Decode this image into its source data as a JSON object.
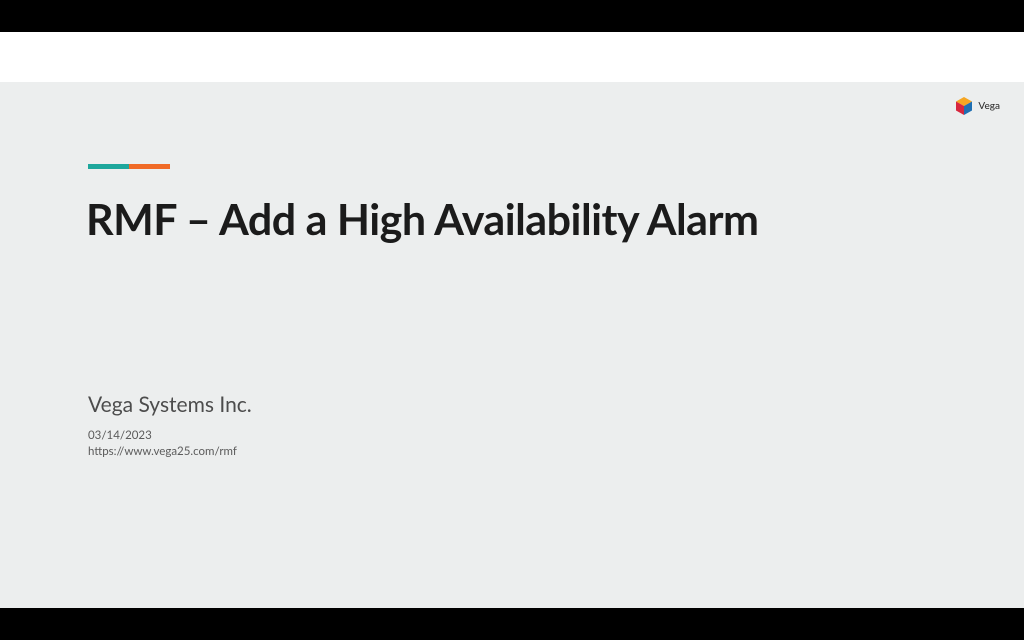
{
  "brand": {
    "name": "Vega"
  },
  "slide": {
    "title": "RMF – Add a High Availability Alarm",
    "company": "Vega Systems Inc.",
    "date": "03/14/2023",
    "url": "https://www.vega25.com/rmf"
  },
  "colors": {
    "accent_teal": "#1ea79c",
    "accent_orange": "#f06a26",
    "slide_bg": "#eceeee"
  }
}
